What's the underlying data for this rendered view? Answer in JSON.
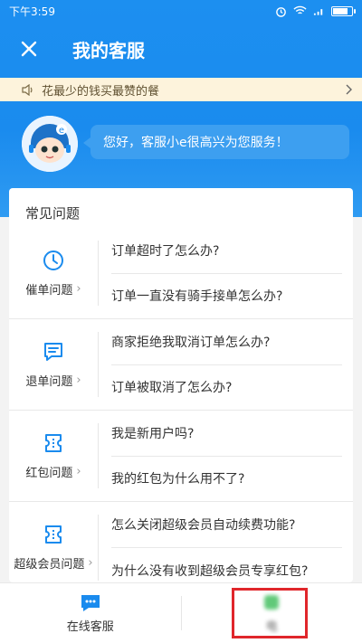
{
  "status_bar": {
    "time": "下午3:59"
  },
  "nav": {
    "title": "我的客服"
  },
  "notice": {
    "text": "花最少的钱买最赞的餐"
  },
  "welcome": {
    "message": "您好，客服小e很高兴为您服务！"
  },
  "faq": {
    "title": "常见问题",
    "sections": [
      {
        "category": "催单问题",
        "icon": "clock-icon",
        "questions": [
          "订单超时了怎么办?",
          "订单一直没有骑手接单怎么办?"
        ]
      },
      {
        "category": "退单问题",
        "icon": "message-icon",
        "questions": [
          "商家拒绝我取消订单怎么办?",
          "订单被取消了怎么办?"
        ]
      },
      {
        "category": "红包问题",
        "icon": "ticket-icon",
        "questions": [
          "我是新用户吗?",
          "我的红包为什么用不了?"
        ]
      },
      {
        "category": "超级会员问题",
        "icon": "ticket-icon",
        "questions": [
          "怎么关闭超级会员自动续费功能?",
          "为什么没有收到超级会员专享红包?"
        ]
      }
    ]
  },
  "bottom_bar": {
    "online_label": "在线客服",
    "phone_label": "电"
  },
  "colors": {
    "accent": "#1a8bee",
    "highlight": "#e0262b"
  }
}
